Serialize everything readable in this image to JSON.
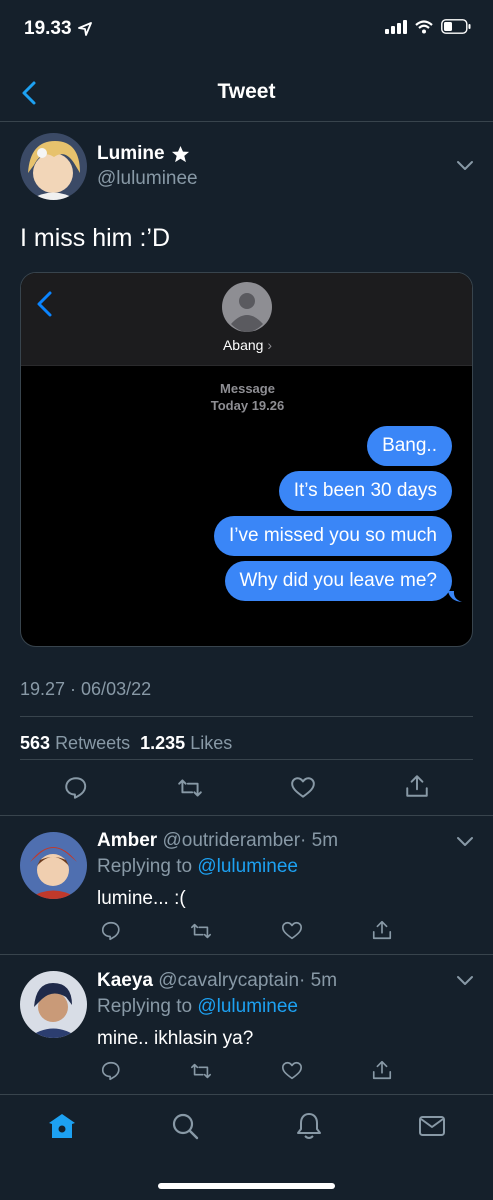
{
  "status_bar": {
    "time": "19.33"
  },
  "nav": {
    "title": "Tweet"
  },
  "author": {
    "name": "Lumine",
    "handle": "@luluminee"
  },
  "tweet": {
    "text": "I miss him :’D",
    "timestamp": "19.27 · 06/03/22",
    "retweets_count": "563",
    "retweets_label": "Retweets",
    "likes_count": "1.235",
    "likes_label": "Likes"
  },
  "embedded_chat": {
    "contact_name": "Abang",
    "meta_label": "Message",
    "meta_time": "Today 19.26",
    "messages": [
      "Bang..",
      "It’s been 30 days",
      "I’ve missed you so much",
      "Why did you leave me?"
    ]
  },
  "replies": [
    {
      "name": "Amber",
      "handle": "@outrideramber",
      "age": "· 5m",
      "replying_prefix": "Replying to",
      "replying_to": "@luluminee",
      "text": "lumine... :("
    },
    {
      "name": "Kaeya",
      "handle": "@cavalrycaptain",
      "age": "· 5m",
      "replying_prefix": "Replying to",
      "replying_to": "@luluminee",
      "text": "mine.. ikhlasin ya?"
    }
  ],
  "colors": {
    "background": "#15202b",
    "accent": "#1da1f2",
    "bubble": "#3a86f7",
    "muted": "#8899a6"
  },
  "icons": [
    "location-arrow-icon",
    "signal-icon",
    "wifi-icon",
    "battery-icon",
    "back-chevron-icon",
    "star-icon",
    "chevron-down-icon",
    "reply-icon",
    "retweet-icon",
    "like-icon",
    "share-icon",
    "home-icon",
    "search-icon",
    "notifications-icon",
    "messages-icon"
  ]
}
